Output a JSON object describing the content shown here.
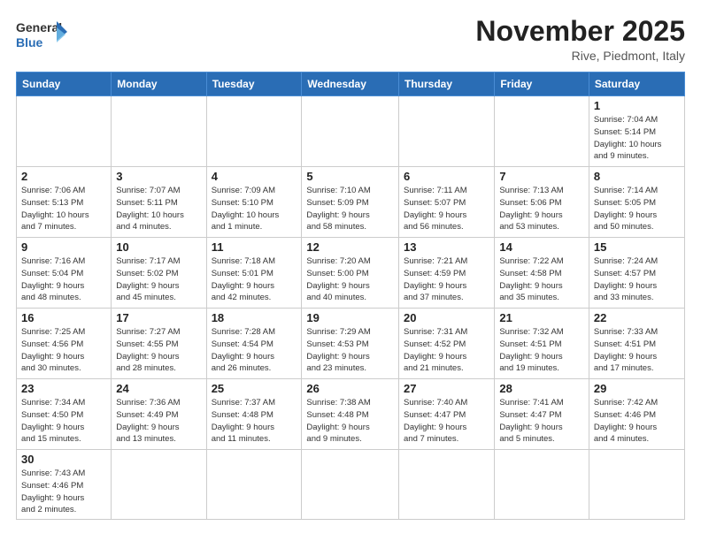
{
  "header": {
    "logo_general": "General",
    "logo_blue": "Blue",
    "month_title": "November 2025",
    "subtitle": "Rive, Piedmont, Italy"
  },
  "weekdays": [
    "Sunday",
    "Monday",
    "Tuesday",
    "Wednesday",
    "Thursday",
    "Friday",
    "Saturday"
  ],
  "weeks": [
    [
      {
        "day": "",
        "info": ""
      },
      {
        "day": "",
        "info": ""
      },
      {
        "day": "",
        "info": ""
      },
      {
        "day": "",
        "info": ""
      },
      {
        "day": "",
        "info": ""
      },
      {
        "day": "",
        "info": ""
      },
      {
        "day": "1",
        "info": "Sunrise: 7:04 AM\nSunset: 5:14 PM\nDaylight: 10 hours\nand 9 minutes."
      }
    ],
    [
      {
        "day": "2",
        "info": "Sunrise: 7:06 AM\nSunset: 5:13 PM\nDaylight: 10 hours\nand 7 minutes."
      },
      {
        "day": "3",
        "info": "Sunrise: 7:07 AM\nSunset: 5:11 PM\nDaylight: 10 hours\nand 4 minutes."
      },
      {
        "day": "4",
        "info": "Sunrise: 7:09 AM\nSunset: 5:10 PM\nDaylight: 10 hours\nand 1 minute."
      },
      {
        "day": "5",
        "info": "Sunrise: 7:10 AM\nSunset: 5:09 PM\nDaylight: 9 hours\nand 58 minutes."
      },
      {
        "day": "6",
        "info": "Sunrise: 7:11 AM\nSunset: 5:07 PM\nDaylight: 9 hours\nand 56 minutes."
      },
      {
        "day": "7",
        "info": "Sunrise: 7:13 AM\nSunset: 5:06 PM\nDaylight: 9 hours\nand 53 minutes."
      },
      {
        "day": "8",
        "info": "Sunrise: 7:14 AM\nSunset: 5:05 PM\nDaylight: 9 hours\nand 50 minutes."
      }
    ],
    [
      {
        "day": "9",
        "info": "Sunrise: 7:16 AM\nSunset: 5:04 PM\nDaylight: 9 hours\nand 48 minutes."
      },
      {
        "day": "10",
        "info": "Sunrise: 7:17 AM\nSunset: 5:02 PM\nDaylight: 9 hours\nand 45 minutes."
      },
      {
        "day": "11",
        "info": "Sunrise: 7:18 AM\nSunset: 5:01 PM\nDaylight: 9 hours\nand 42 minutes."
      },
      {
        "day": "12",
        "info": "Sunrise: 7:20 AM\nSunset: 5:00 PM\nDaylight: 9 hours\nand 40 minutes."
      },
      {
        "day": "13",
        "info": "Sunrise: 7:21 AM\nSunset: 4:59 PM\nDaylight: 9 hours\nand 37 minutes."
      },
      {
        "day": "14",
        "info": "Sunrise: 7:22 AM\nSunset: 4:58 PM\nDaylight: 9 hours\nand 35 minutes."
      },
      {
        "day": "15",
        "info": "Sunrise: 7:24 AM\nSunset: 4:57 PM\nDaylight: 9 hours\nand 33 minutes."
      }
    ],
    [
      {
        "day": "16",
        "info": "Sunrise: 7:25 AM\nSunset: 4:56 PM\nDaylight: 9 hours\nand 30 minutes."
      },
      {
        "day": "17",
        "info": "Sunrise: 7:27 AM\nSunset: 4:55 PM\nDaylight: 9 hours\nand 28 minutes."
      },
      {
        "day": "18",
        "info": "Sunrise: 7:28 AM\nSunset: 4:54 PM\nDaylight: 9 hours\nand 26 minutes."
      },
      {
        "day": "19",
        "info": "Sunrise: 7:29 AM\nSunset: 4:53 PM\nDaylight: 9 hours\nand 23 minutes."
      },
      {
        "day": "20",
        "info": "Sunrise: 7:31 AM\nSunset: 4:52 PM\nDaylight: 9 hours\nand 21 minutes."
      },
      {
        "day": "21",
        "info": "Sunrise: 7:32 AM\nSunset: 4:51 PM\nDaylight: 9 hours\nand 19 minutes."
      },
      {
        "day": "22",
        "info": "Sunrise: 7:33 AM\nSunset: 4:51 PM\nDaylight: 9 hours\nand 17 minutes."
      }
    ],
    [
      {
        "day": "23",
        "info": "Sunrise: 7:34 AM\nSunset: 4:50 PM\nDaylight: 9 hours\nand 15 minutes."
      },
      {
        "day": "24",
        "info": "Sunrise: 7:36 AM\nSunset: 4:49 PM\nDaylight: 9 hours\nand 13 minutes."
      },
      {
        "day": "25",
        "info": "Sunrise: 7:37 AM\nSunset: 4:48 PM\nDaylight: 9 hours\nand 11 minutes."
      },
      {
        "day": "26",
        "info": "Sunrise: 7:38 AM\nSunset: 4:48 PM\nDaylight: 9 hours\nand 9 minutes."
      },
      {
        "day": "27",
        "info": "Sunrise: 7:40 AM\nSunset: 4:47 PM\nDaylight: 9 hours\nand 7 minutes."
      },
      {
        "day": "28",
        "info": "Sunrise: 7:41 AM\nSunset: 4:47 PM\nDaylight: 9 hours\nand 5 minutes."
      },
      {
        "day": "29",
        "info": "Sunrise: 7:42 AM\nSunset: 4:46 PM\nDaylight: 9 hours\nand 4 minutes."
      }
    ],
    [
      {
        "day": "30",
        "info": "Sunrise: 7:43 AM\nSunset: 4:46 PM\nDaylight: 9 hours\nand 2 minutes."
      },
      {
        "day": "",
        "info": ""
      },
      {
        "day": "",
        "info": ""
      },
      {
        "day": "",
        "info": ""
      },
      {
        "day": "",
        "info": ""
      },
      {
        "day": "",
        "info": ""
      },
      {
        "day": "",
        "info": ""
      }
    ]
  ]
}
